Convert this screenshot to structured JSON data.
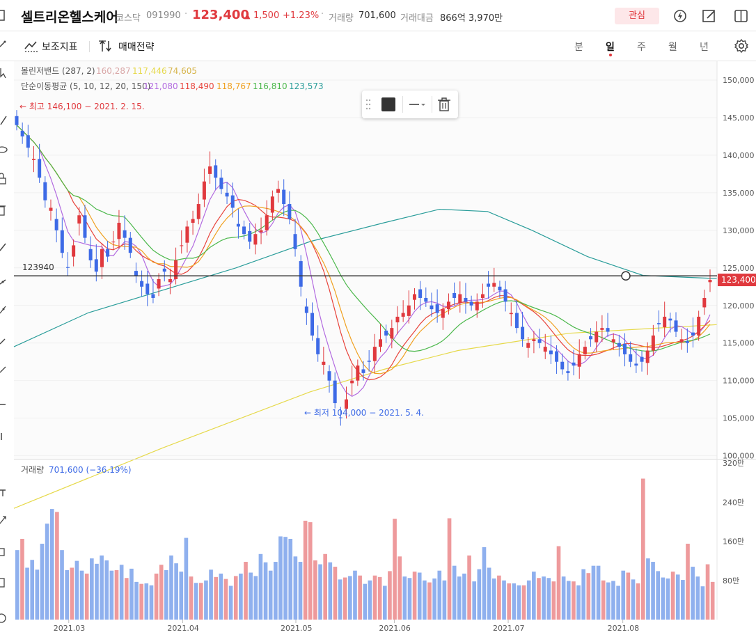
{
  "header": {
    "stock_name": "셀트리온헬스케어",
    "market": "코스닥",
    "code": "091990",
    "price": "123,400",
    "change_arrow": "▲",
    "change": "1,500",
    "change_rate": "+1.23%",
    "volume_label": "거래량",
    "volume": "701,600",
    "amount_label": "거래대금",
    "amount": "866억 3,970만",
    "favorite_button": "관심",
    "colors": {
      "up": "#e0393e",
      "down": "#3d6ae6",
      "favorite_bg": "#fde7e9"
    }
  },
  "toolbar": {
    "indicator_label": "보조지표",
    "strategy_label": "매매전략",
    "periods": [
      "분",
      "일",
      "주",
      "월",
      "년"
    ],
    "active_period": "일"
  },
  "legend": {
    "bollinger_label": "볼린저밴드 (287, 2)",
    "bollinger_values": [
      "160,287",
      "117,446",
      "74,605"
    ],
    "bollinger_colors": [
      "#d9a7a7",
      "#e6d94a",
      "#d6b44a"
    ],
    "ma_label": "단순이동평균 (5, 10, 12, 20, 150)",
    "ma_values": [
      "121,080",
      "118,490",
      "118,767",
      "116,810",
      "123,573"
    ],
    "ma_colors": [
      "#b26ae0",
      "#e8443c",
      "#f0a020",
      "#4cb84c",
      "#2a9d9a"
    ],
    "high_note": "← 최고 146,100 − 2021. 2. 15.",
    "low_note": "← 최저 104,000 − 2021. 5. 4.",
    "hline_value": "123940",
    "current_price_tag": "123,400",
    "volume_label": "거래량",
    "volume_value": "701,600 (−36.19%)"
  },
  "chart_data": {
    "type": "candlestick",
    "price_axis": {
      "ylim": [
        99500,
        152500
      ],
      "ticks": [
        "150,000",
        "145,000",
        "140,000",
        "135,000",
        "130,000",
        "125,000",
        "120,000",
        "115,000",
        "110,000",
        "105,000",
        "100,000"
      ]
    },
    "volume_axis": {
      "ylim": [
        0,
        3200000
      ],
      "ticks": [
        "320만",
        "240만",
        "160만",
        "80만"
      ]
    },
    "x_labels": [
      "2021.03",
      "2021.04",
      "2021.05",
      "2021.06",
      "2021.07",
      "2021.08"
    ],
    "horizontal_line": 123940,
    "series_close": [
      144000,
      142500,
      141000,
      139500,
      137000,
      134000,
      133000,
      130000,
      127000,
      125000,
      128000,
      132000,
      129000,
      126000,
      124500,
      127500,
      126500,
      128500,
      131000,
      129000,
      127000,
      124000,
      122500,
      121500,
      121000,
      123500,
      124500,
      123500,
      126000,
      128000,
      130500,
      131500,
      133500,
      136500,
      138500,
      137000,
      135500,
      134500,
      133000,
      130500,
      129500,
      128500,
      129500,
      130000,
      132000,
      134500,
      135500,
      133500,
      131500,
      127500,
      122500,
      119000,
      116000,
      113500,
      112500,
      110000,
      107000,
      105000,
      107500,
      110000,
      112000,
      111000,
      112500,
      114500,
      115500,
      116000,
      117000,
      118500,
      119000,
      120000,
      121500,
      121000,
      120500,
      119500,
      119000,
      119500,
      120500,
      121000,
      121500,
      120500,
      120000,
      120500,
      121500,
      122500,
      123000,
      122000,
      120500,
      119000,
      117000,
      115500,
      115000,
      115500,
      115000,
      114500,
      113500,
      112500,
      111500,
      111000,
      112000,
      113500,
      114500,
      115500,
      116500,
      117000,
      116500,
      115500,
      114500,
      113500,
      112500,
      112000,
      112500,
      114000,
      116000,
      117500,
      118500,
      118000,
      116500,
      115500,
      115000,
      116000,
      118500,
      121000,
      123400
    ],
    "volume_bars": [
      [
        1420000,
        "d"
      ],
      [
        1650000,
        "u"
      ],
      [
        1060000,
        "d"
      ],
      [
        1220000,
        "d"
      ],
      [
        1020000,
        "d"
      ],
      [
        1550000,
        "d"
      ],
      [
        1960000,
        "d"
      ],
      [
        2260000,
        "d"
      ],
      [
        2200000,
        "u"
      ],
      [
        1420000,
        "d"
      ],
      [
        1010000,
        "d"
      ],
      [
        1060000,
        "u"
      ],
      [
        1200000,
        "d"
      ],
      [
        1000000,
        "d"
      ],
      [
        940000,
        "u"
      ],
      [
        1250000,
        "d"
      ],
      [
        1140000,
        "d"
      ],
      [
        1310000,
        "d"
      ],
      [
        1210000,
        "d"
      ],
      [
        1000000,
        "d"
      ],
      [
        1010000,
        "u"
      ],
      [
        1120000,
        "d"
      ],
      [
        850000,
        "u"
      ],
      [
        1040000,
        "d"
      ],
      [
        770000,
        "d"
      ],
      [
        730000,
        "u"
      ],
      [
        740000,
        "d"
      ],
      [
        700000,
        "d"
      ],
      [
        940000,
        "u"
      ],
      [
        1120000,
        "u"
      ],
      [
        1010000,
        "d"
      ],
      [
        1310000,
        "d"
      ],
      [
        1150000,
        "d"
      ],
      [
        980000,
        "d"
      ],
      [
        1670000,
        "d"
      ],
      [
        880000,
        "u"
      ],
      [
        750000,
        "d"
      ],
      [
        750000,
        "u"
      ],
      [
        800000,
        "d"
      ],
      [
        1020000,
        "d"
      ],
      [
        870000,
        "u"
      ],
      [
        940000,
        "d"
      ],
      [
        830000,
        "u"
      ],
      [
        690000,
        "d"
      ],
      [
        890000,
        "u"
      ],
      [
        940000,
        "d"
      ],
      [
        1180000,
        "u"
      ],
      [
        960000,
        "d"
      ],
      [
        890000,
        "d"
      ],
      [
        1340000,
        "d"
      ],
      [
        1170000,
        "d"
      ],
      [
        1000000,
        "d"
      ],
      [
        1180000,
        "d"
      ],
      [
        1700000,
        "d"
      ],
      [
        1690000,
        "d"
      ],
      [
        1650000,
        "d"
      ],
      [
        1290000,
        "d"
      ],
      [
        1180000,
        "d"
      ],
      [
        2020000,
        "u"
      ],
      [
        1990000,
        "u"
      ],
      [
        1210000,
        "u"
      ],
      [
        1130000,
        "d"
      ],
      [
        1340000,
        "u"
      ],
      [
        1170000,
        "d"
      ],
      [
        1080000,
        "u"
      ],
      [
        820000,
        "d"
      ],
      [
        860000,
        "u"
      ],
      [
        890000,
        "d"
      ],
      [
        1000000,
        "d"
      ],
      [
        900000,
        "u"
      ],
      [
        730000,
        "d"
      ],
      [
        800000,
        "d"
      ],
      [
        900000,
        "u"
      ],
      [
        870000,
        "u"
      ],
      [
        690000,
        "d"
      ],
      [
        990000,
        "u"
      ],
      [
        2060000,
        "u"
      ],
      [
        1290000,
        "u"
      ],
      [
        880000,
        "d"
      ],
      [
        850000,
        "d"
      ],
      [
        980000,
        "u"
      ],
      [
        960000,
        "d"
      ],
      [
        800000,
        "d"
      ],
      [
        760000,
        "u"
      ],
      [
        840000,
        "d"
      ],
      [
        1000000,
        "d"
      ],
      [
        800000,
        "d"
      ],
      [
        2070000,
        "u"
      ],
      [
        1100000,
        "d"
      ],
      [
        880000,
        "d"
      ],
      [
        940000,
        "d"
      ],
      [
        1310000,
        "u"
      ],
      [
        780000,
        "d"
      ],
      [
        1030000,
        "d"
      ],
      [
        1480000,
        "d"
      ],
      [
        1060000,
        "d"
      ],
      [
        840000,
        "d"
      ],
      [
        900000,
        "u"
      ],
      [
        800000,
        "d"
      ],
      [
        740000,
        "u"
      ],
      [
        740000,
        "d"
      ],
      [
        700000,
        "d"
      ],
      [
        700000,
        "u"
      ],
      [
        800000,
        "d"
      ],
      [
        980000,
        "d"
      ],
      [
        850000,
        "u"
      ],
      [
        880000,
        "d"
      ],
      [
        850000,
        "d"
      ],
      [
        780000,
        "u"
      ],
      [
        1500000,
        "u"
      ],
      [
        880000,
        "d"
      ],
      [
        790000,
        "d"
      ],
      [
        780000,
        "u"
      ],
      [
        700000,
        "d"
      ],
      [
        1030000,
        "d"
      ],
      [
        950000,
        "u"
      ],
      [
        1100000,
        "d"
      ],
      [
        1100000,
        "d"
      ],
      [
        800000,
        "u"
      ],
      [
        760000,
        "d"
      ],
      [
        790000,
        "d"
      ],
      [
        690000,
        "d"
      ],
      [
        1000000,
        "d"
      ],
      [
        960000,
        "u"
      ],
      [
        820000,
        "d"
      ],
      [
        740000,
        "u"
      ],
      [
        2880000,
        "u"
      ],
      [
        1250000,
        "d"
      ],
      [
        1180000,
        "d"
      ],
      [
        990000,
        "d"
      ],
      [
        860000,
        "d"
      ],
      [
        840000,
        "d"
      ],
      [
        980000,
        "u"
      ],
      [
        920000,
        "d"
      ],
      [
        810000,
        "d"
      ],
      [
        1550000,
        "u"
      ],
      [
        1080000,
        "d"
      ],
      [
        880000,
        "d"
      ],
      [
        680000,
        "d"
      ],
      [
        1130000,
        "u"
      ],
      [
        770000,
        "u"
      ]
    ]
  }
}
